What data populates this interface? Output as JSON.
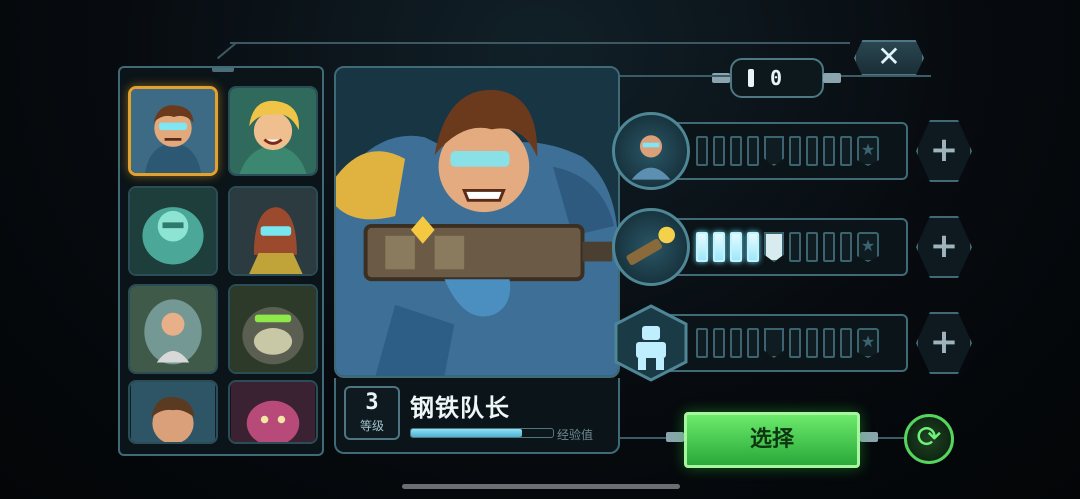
{
  "top_bar": {
    "close_icon": "close-x-icon",
    "close_label": "✕",
    "resource_count": "0"
  },
  "roster": {
    "heroes": [
      {
        "id": "steel-captain",
        "selected": true,
        "color": "#3d6b85"
      },
      {
        "id": "blonde-hero",
        "selected": false,
        "color": "#2f6a5c"
      },
      {
        "id": "ghost-hero",
        "selected": false,
        "color": "#3a7d70"
      },
      {
        "id": "robot-hero",
        "selected": false,
        "color": "#6a3b2e"
      },
      {
        "id": "pilot-hero",
        "selected": false,
        "color": "#4f6a50"
      },
      {
        "id": "gorilla-hero",
        "selected": false,
        "color": "#3d4a38"
      },
      {
        "id": "soldier-hero",
        "selected": false,
        "color": "#2e5566"
      },
      {
        "id": "octopus-hero",
        "selected": false,
        "color": "#6d2c4a"
      }
    ]
  },
  "hero": {
    "level": "3",
    "level_label": "等级",
    "name": "钢铁队长",
    "xp_label": "经验值",
    "xp_fraction": 0.78
  },
  "upgrades": [
    {
      "icon": "soldier-portrait-icon",
      "filled": 0,
      "plus_label": "+"
    },
    {
      "icon": "gun-blast-icon",
      "filled": 4,
      "plus_label": "+"
    },
    {
      "icon": "mech-robot-icon",
      "filled": 0,
      "plus_label": "+"
    }
  ],
  "actions": {
    "select_label": "选择",
    "refresh_icon": "⟳"
  },
  "colors": {
    "accent_cyan": "#6fdcf5",
    "select_green": "#3ac94a",
    "selected_gold": "#e4a22c"
  }
}
